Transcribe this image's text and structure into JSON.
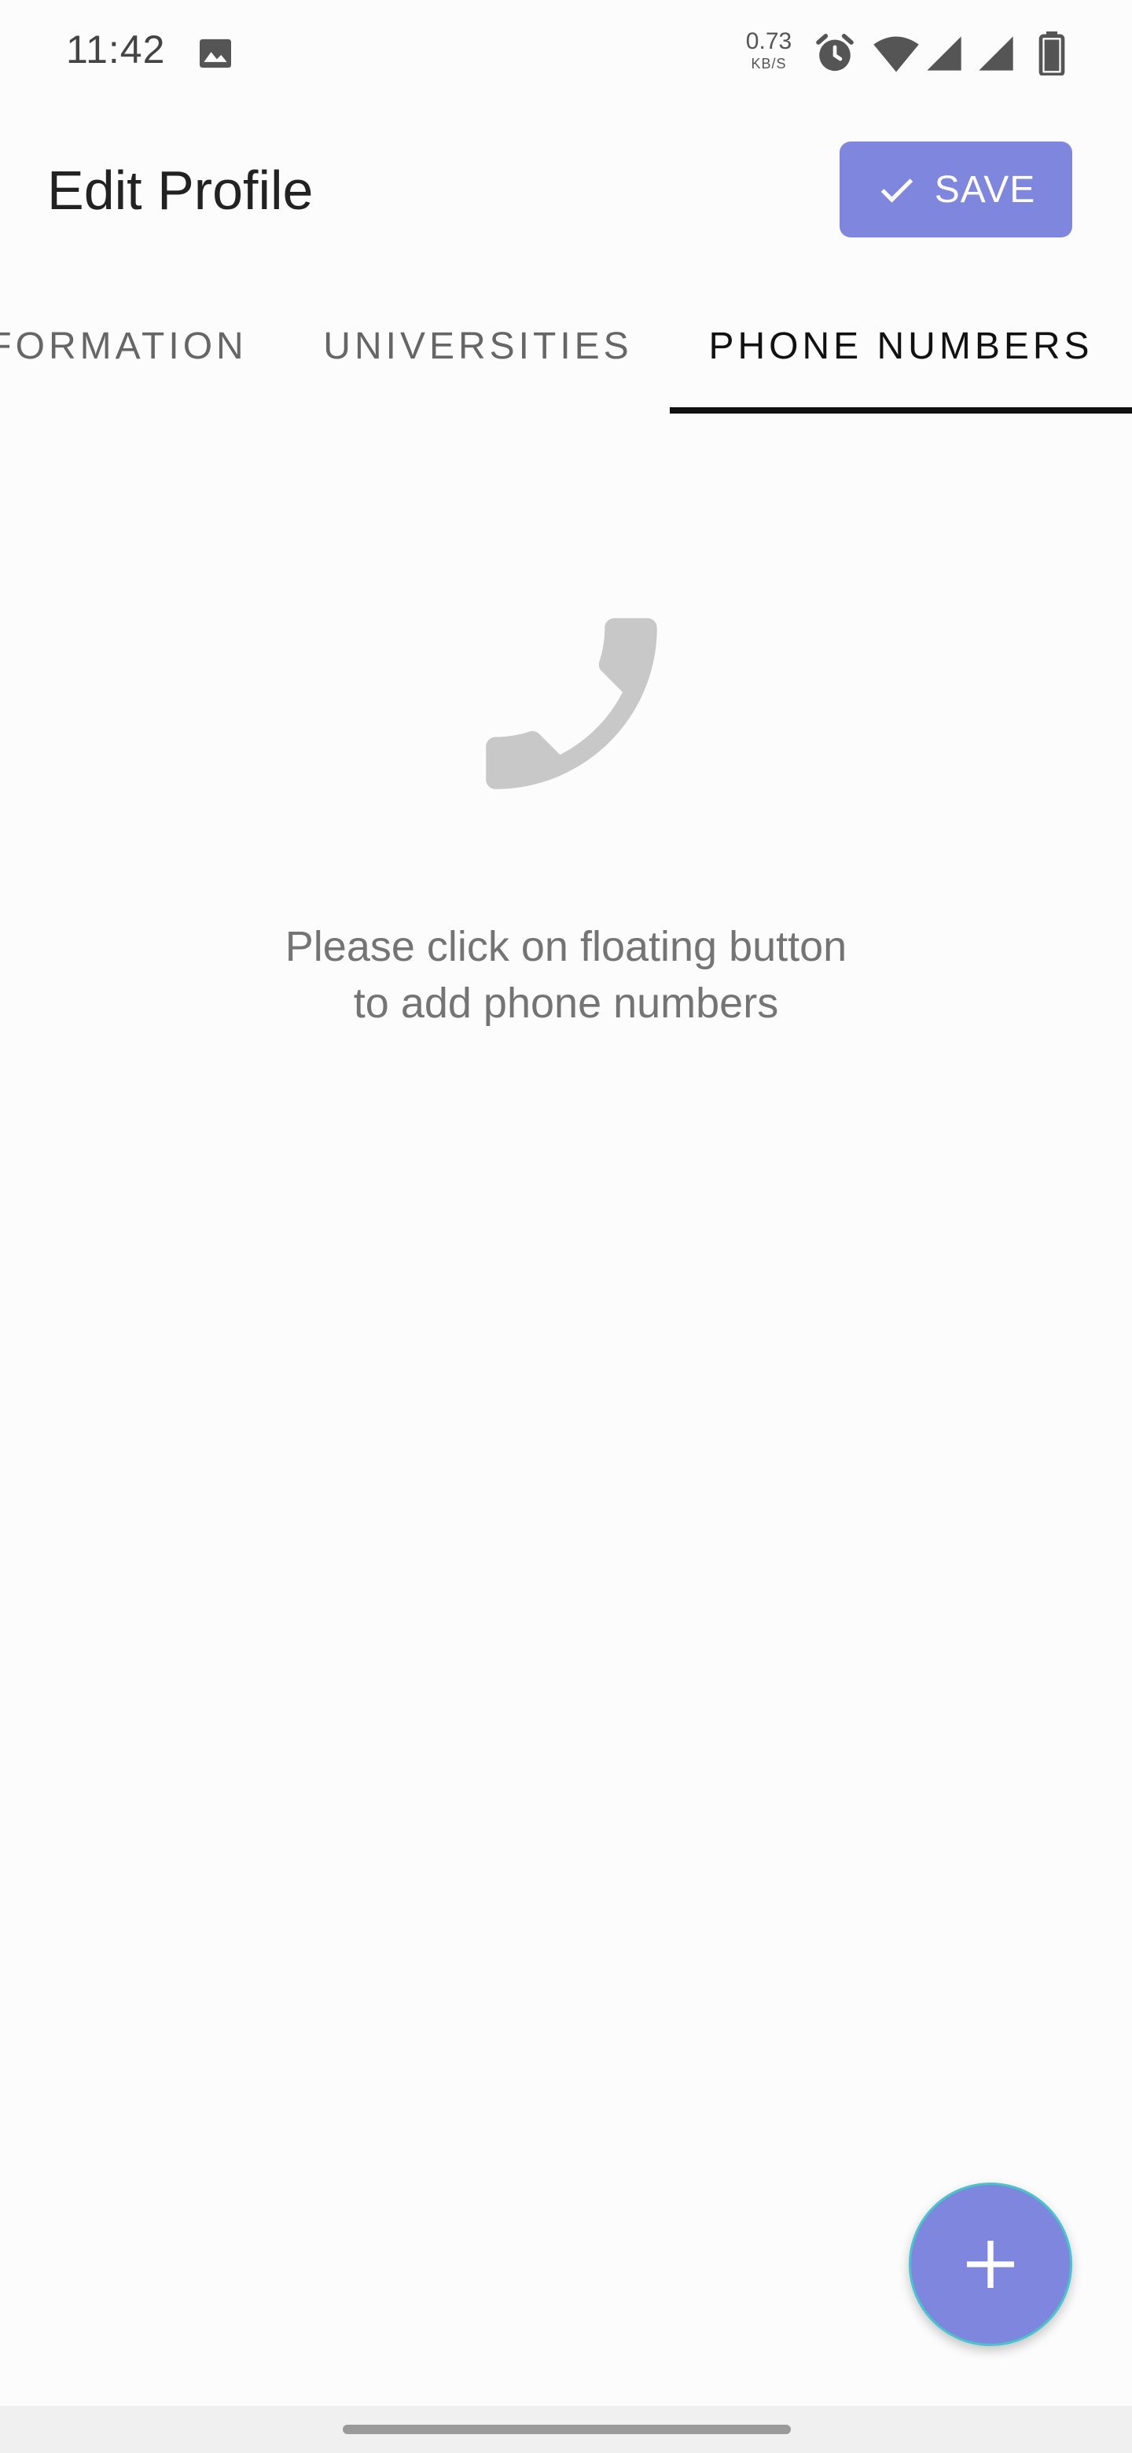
{
  "status_bar": {
    "time": "11:42",
    "net_speed_value": "0.73",
    "net_speed_unit": "KB/S",
    "icons": [
      "gallery-icon",
      "alarm-icon",
      "wifi-icon",
      "signal-icon",
      "signal-icon",
      "battery-icon"
    ]
  },
  "app_bar": {
    "title": "Edit Profile",
    "save_label": "SAVE",
    "save_icon": "check-icon"
  },
  "tabs": [
    {
      "label": "FORMATION",
      "selected": false
    },
    {
      "label": "UNIVERSITIES",
      "selected": false
    },
    {
      "label": "PHONE NUMBERS",
      "selected": true
    }
  ],
  "empty_state": {
    "icon": "phone-icon",
    "line1": "Please click on floating button",
    "line2": "to add phone numbers"
  },
  "fab": {
    "icon": "plus-icon"
  },
  "colors": {
    "accent": "#7e86dd",
    "fab_border": "#48c4cc",
    "empty_icon": "#c8c8c8",
    "text_muted": "#747474"
  }
}
